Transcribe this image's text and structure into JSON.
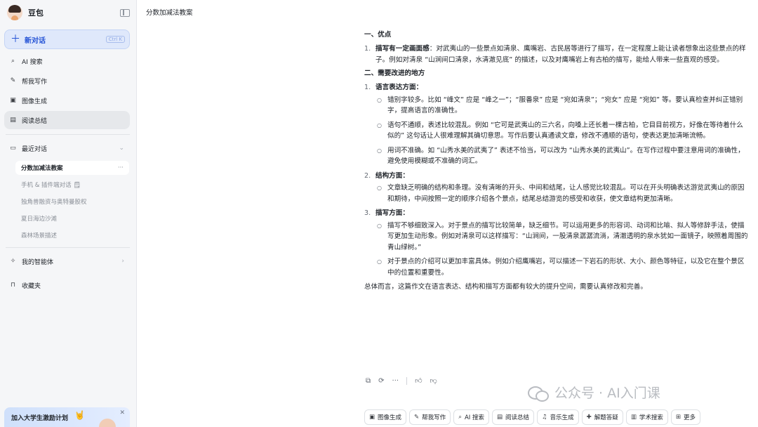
{
  "sidebar": {
    "brand": "豆包",
    "new_chat": "新对话",
    "new_chat_shortcut": "Ctrl K",
    "nav": [
      {
        "label": "AI 搜索",
        "icon": "search-icon"
      },
      {
        "label": "帮我写作",
        "icon": "pen-icon"
      },
      {
        "label": "图像生成",
        "icon": "image-icon"
      },
      {
        "label": "阅读总结",
        "icon": "read-icon"
      }
    ],
    "recent_label": "最近对话",
    "recent": [
      {
        "label": "分数加减法教案"
      },
      {
        "label": "手机 & 插件端对话 🗒"
      },
      {
        "label": "独角兽融资与奥特曼股权"
      },
      {
        "label": "夏日海边沙滩"
      },
      {
        "label": "森林场景描述"
      }
    ],
    "agents_label": "我的智能体",
    "favorites_label": "收藏夹",
    "promo": "加入大学生激励计划"
  },
  "conversation_title": "分数加减法教案",
  "message": {
    "s1_title": "一、优点",
    "s1_items": [
      {
        "num": "1.",
        "bold": "描写有一定画面感",
        "text": "：对武夷山的一些景点如清泉、鹰嘴岩、古民居等进行了描写，在一定程度上能让读者想象出这些景点的样子。例如对清泉 “山涧间口清泉，水清澈见底” 的描述，以及对鹰嘴岩上有古柏的描写，能给人带来一些直观的感受。"
      }
    ],
    "s2_title": "二、需要改进的地方",
    "g1_title": "语言表达方面",
    "g1_items": [
      "错别字较多。比如 “峰文” 应是 “峰之一”；“服番泉” 应是 “宛如清泉”；“宛女” 应是 “宛如” 等。要认真检查并纠正错别字，提高语言的准确性。",
      "语句不通顺，表述比较混乱。例如 “它可是武夷山的三六名，向嗓上还长着一棵古柏，它目目前视方，好像在等待着什么似的” 这句话让人很难理解其确切意思。写作后要认真通读文章，修改不通顺的语句，使表达更加清晰流畅。",
      "用词不准确。如 “山秀水美的武夷了” 表述不恰当，可以改为 “山秀水美的武夷山”。在写作过程中要注意用词的准确性，避免使用模糊或不准确的词汇。"
    ],
    "g2_title": "结构方面",
    "g2_items": [
      "文章缺乏明确的结构和条理。没有清晰的开头、中间和结尾，让人感觉比较混乱。可以在开头明确表达游览武夷山的原因和期待，中间按照一定的顺序介绍各个景点，结尾总结游览的感受和收获，使文章结构更加清晰。"
    ],
    "g3_title": "描写方面",
    "g3_items": [
      "描写不够细致深入。对于景点的描写比较简单，缺乏细节。可以运用更多的形容词、动词和比喻、拟人等修辞手法，使描写更加生动形象。例如对清泉可以这样描写：“山涧间，一股清泉潺潺流淌，清澈透明的泉水犹如一面镜子，映照着周围的青山绿树。”",
      "对于景点的介绍可以更加丰富具体。例如介绍鹰嘴岩，可以描述一下岩石的形状、大小、颜色等特征，以及它在整个景区中的位置和重要性。"
    ],
    "summary": "总体而言，这篇作文在语言表达、结构和描写方面都有较大的提升空间，需要认真修改和完善。"
  },
  "toolbar": [
    {
      "label": "图像生成",
      "icon": "image-icon",
      "glyph": "▣"
    },
    {
      "label": "帮我写作",
      "icon": "pen-icon",
      "glyph": "✎"
    },
    {
      "label": "AI 搜索",
      "icon": "search-icon",
      "glyph": "⌕"
    },
    {
      "label": "阅读总结",
      "icon": "read-icon",
      "glyph": "▤"
    },
    {
      "label": "音乐生成",
      "icon": "music-icon",
      "glyph": "♫"
    },
    {
      "label": "解题答疑",
      "icon": "question-icon",
      "glyph": "✚"
    },
    {
      "label": "学术搜索",
      "icon": "book-icon",
      "glyph": "▥"
    },
    {
      "label": "更多",
      "icon": "grid-icon",
      "glyph": "⊞"
    }
  ],
  "watermark": "公众号 · AI入门课"
}
